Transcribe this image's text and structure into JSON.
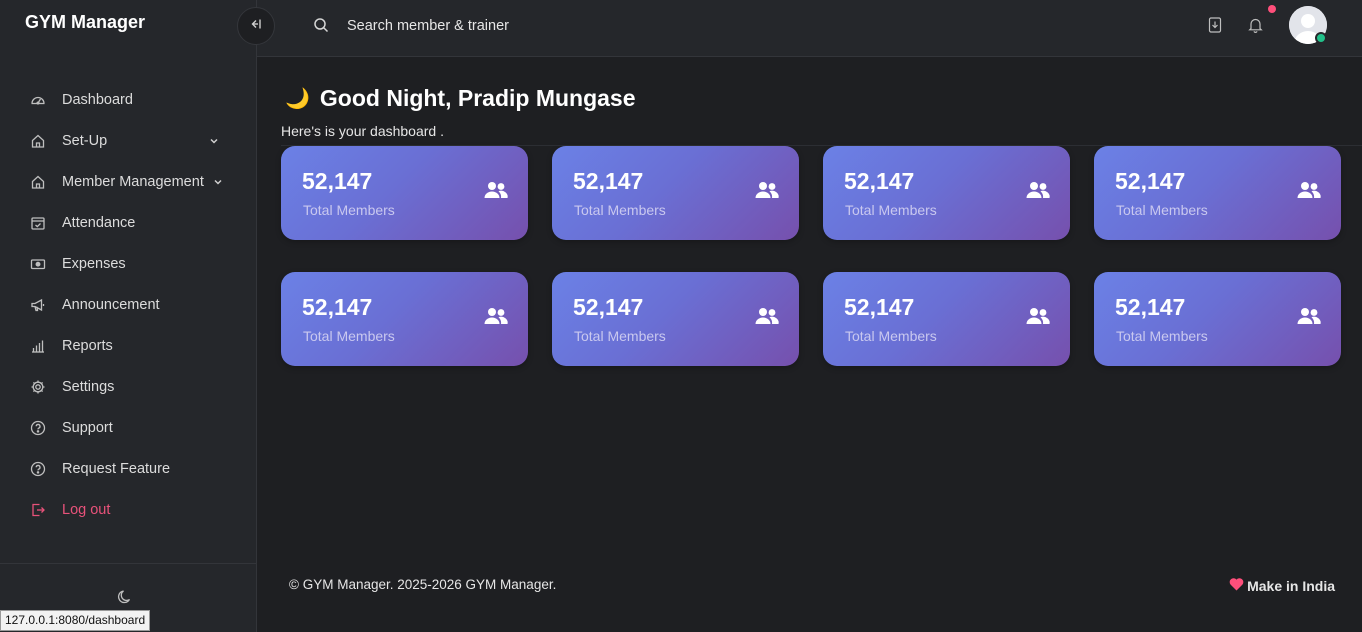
{
  "app": {
    "brand": "GYM Manager"
  },
  "sidebar": {
    "items": [
      {
        "label": "Dashboard",
        "icon": "dashboard-icon"
      },
      {
        "label": "Set-Up",
        "icon": "home-icon",
        "has_submenu": true
      },
      {
        "label": "Member Management",
        "icon": "home-icon",
        "has_submenu": true
      },
      {
        "label": "Attendance",
        "icon": "calendar-check-icon"
      },
      {
        "label": "Expenses",
        "icon": "cash-icon"
      },
      {
        "label": "Announcement",
        "icon": "megaphone-icon"
      },
      {
        "label": "Reports",
        "icon": "bar-chart-icon"
      },
      {
        "label": "Settings",
        "icon": "gear-icon"
      },
      {
        "label": "Support",
        "icon": "help-circle-icon"
      },
      {
        "label": "Request Feature",
        "icon": "help-circle-icon"
      },
      {
        "label": "Log out",
        "icon": "logout-icon",
        "color": "#e8527a"
      }
    ]
  },
  "header": {
    "search_placeholder": "Search member & trainer",
    "notification_indicator": true
  },
  "main": {
    "greeting_emoji": "🌙",
    "greeting": "Good Night, Pradip Mungase",
    "subtitle": "Here's is your dashboard .",
    "cards": [
      {
        "value": "52,147",
        "label": "Total Members",
        "icon": "users-icon"
      },
      {
        "value": "52,147",
        "label": "Total Members",
        "icon": "users-icon"
      },
      {
        "value": "52,147",
        "label": "Total Members",
        "icon": "users-icon"
      },
      {
        "value": "52,147",
        "label": "Total Members",
        "icon": "users-icon"
      },
      {
        "value": "52,147",
        "label": "Total Members",
        "icon": "users-icon"
      },
      {
        "value": "52,147",
        "label": "Total Members",
        "icon": "users-icon"
      },
      {
        "value": "52,147",
        "label": "Total Members",
        "icon": "users-icon"
      },
      {
        "value": "52,147",
        "label": "Total Members",
        "icon": "users-icon"
      }
    ]
  },
  "footer": {
    "copyright": "© GYM Manager. 2025-2026 GYM Manager.",
    "made_in": "Make in India"
  },
  "status_bar": {
    "url": "127.0.0.1:8080/dashboard"
  },
  "colors": {
    "background": "#1e1f22",
    "sidebar": "#25272b",
    "accent_logout": "#e8527a",
    "card_gradient_start": "#6b81e6",
    "card_gradient_end": "#7650ad",
    "online": "#22c08a",
    "notification": "#ff4f7b"
  }
}
